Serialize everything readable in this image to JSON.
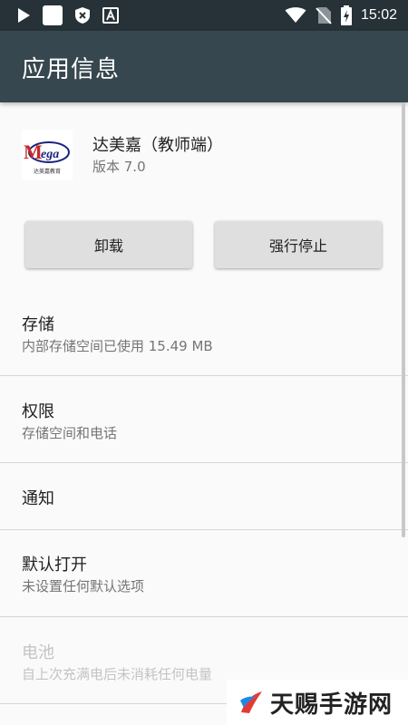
{
  "status_bar": {
    "time": "15:02",
    "left_icons": [
      "play-icon",
      "notification-square-icon",
      "shield-x-icon",
      "font-a-icon"
    ],
    "right_icons": [
      "wifi-icon",
      "no-sim-icon",
      "battery-charging-icon"
    ]
  },
  "app_bar": {
    "title": "应用信息"
  },
  "app": {
    "name": "达美嘉（教师端）",
    "version": "版本 7.0",
    "icon_text": "Mega",
    "icon_caption": "达美嘉教育"
  },
  "buttons": {
    "uninstall": "卸载",
    "force_stop": "强行停止"
  },
  "list": [
    {
      "title": "存储",
      "subtitle": "内部存储空间已使用 15.49 MB",
      "enabled": true
    },
    {
      "title": "权限",
      "subtitle": "存储空间和电话",
      "enabled": true
    },
    {
      "title": "通知",
      "subtitle": "",
      "enabled": true
    },
    {
      "title": "默认打开",
      "subtitle": "未设置任何默认选项",
      "enabled": true
    },
    {
      "title": "电池",
      "subtitle": "自上次充满电后未消耗任何电量",
      "enabled": false
    }
  ],
  "watermark": {
    "text": "天赐手游网"
  },
  "colors": {
    "status_bar": "#263238",
    "app_bar": "#37474f",
    "background": "#fafafa",
    "logo_red": "#c62828",
    "logo_blue": "#1a237e"
  }
}
